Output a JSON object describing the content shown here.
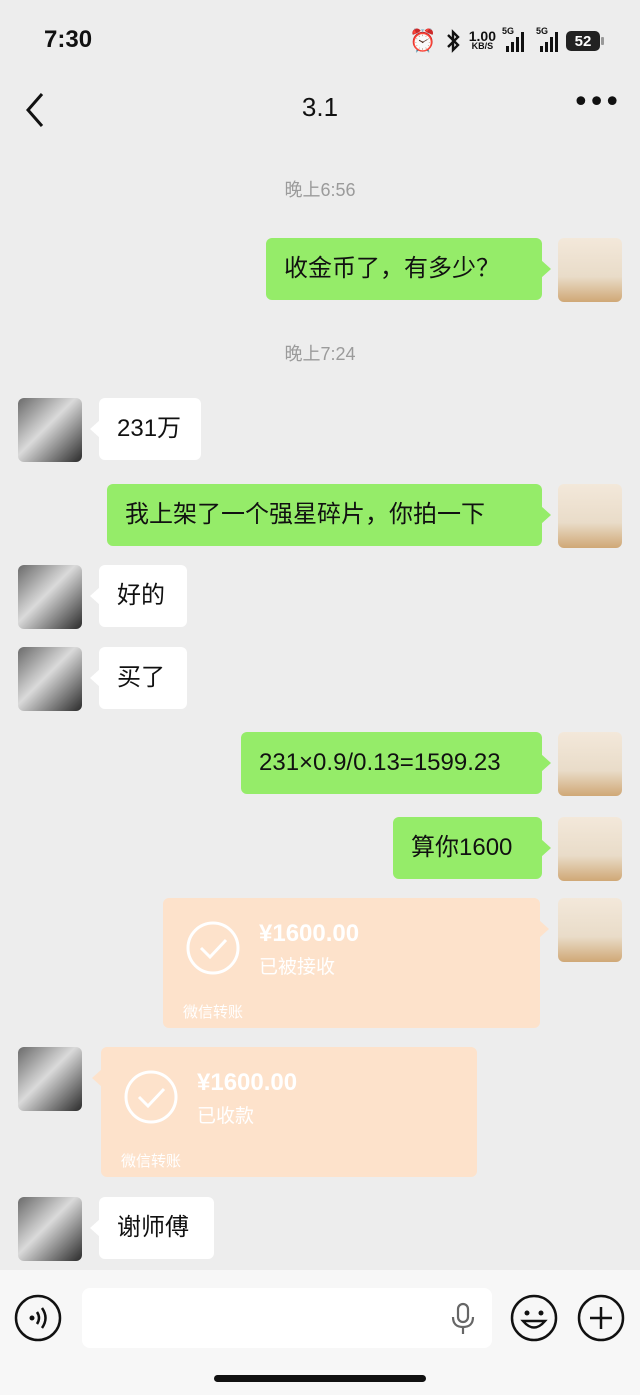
{
  "status_bar": {
    "time": "7:30",
    "net_speed_value": "1.00",
    "net_speed_unit": "KB/S",
    "signal1_tag": "5G",
    "signal2_tag": "5G",
    "battery": "52"
  },
  "nav": {
    "title": "3.1"
  },
  "messages": {
    "ts1": "晚上6:56",
    "m1": "收金币了，有多少？",
    "ts2": "晚上7:24",
    "m2": "231万",
    "m3": "我上架了一个强星碎片，你拍一下",
    "m4": "好的",
    "m5": "买了",
    "m6": "231×0.9/0.13=1599.23",
    "m7": "算你1600",
    "t1_amount": "¥1600.00",
    "t1_status": "已被接收",
    "t1_footer": "微信转账",
    "t2_amount": "¥1600.00",
    "t2_status": "已收款",
    "t2_footer": "微信转账",
    "m8": "谢师傅"
  },
  "input": {
    "placeholder": ""
  },
  "colors": {
    "outgoing_bubble": "#95ec69",
    "incoming_bubble": "#ffffff",
    "transfer_bubble": "#fde2cb",
    "background": "#ededed"
  }
}
